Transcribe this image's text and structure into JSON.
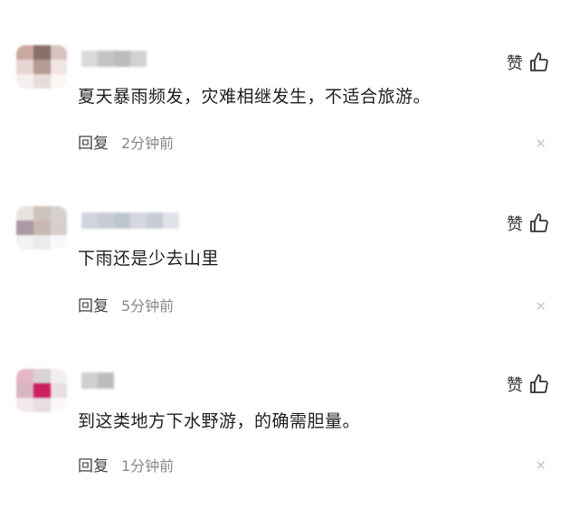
{
  "comments": [
    {
      "text": "夏天暴雨频发，灾难相继发生，不适合旅游。",
      "like_label": "赞",
      "reply_label": "回复",
      "time": "2分钟前",
      "avatar_colors": [
        "#c9a8a0",
        "#8a6f6a",
        "#d8c3bf",
        "#e6d6d3",
        "#b69a94",
        "#f0e5e3",
        "#f5eeee",
        "#e8dcda",
        "#fbf7f7"
      ],
      "name_colors": [
        "#d9d9d9",
        "#c4c4c4",
        "#bcbcbc",
        "#d2d2d2"
      ]
    },
    {
      "text": "下雨还是少去山里",
      "like_label": "赞",
      "reply_label": "回复",
      "time": "5分钟前",
      "avatar_colors": [
        "#e7e2df",
        "#cfc3bd",
        "#d6d0ce",
        "#a99aa5",
        "#c9b7b3",
        "#d8cfcc",
        "#f3f1f1",
        "#eceaea",
        "#faf9f9"
      ],
      "name_colors": [
        "#d0d4dc",
        "#c8ccd4",
        "#bfc5cf",
        "#d5d8de",
        "#c7ccd5",
        "#dfe2e7"
      ]
    },
    {
      "text": "到这类地方下水野游，的确需胆量。",
      "like_label": "赞",
      "reply_label": "回复",
      "time": "1分钟前",
      "avatar_colors": [
        "#e6b6c4",
        "#d8d2d4",
        "#f3eff0",
        "#d8b5bf",
        "#cc1f5e",
        "#e9dfe2",
        "#f2e9ec",
        "#eadde1",
        "#fbf8f9"
      ],
      "name_colors": [
        "#cfcfcf",
        "#bdbdbd"
      ]
    }
  ],
  "colors": {
    "text": "#1e1e1e",
    "secondary": "#888888",
    "close": "#c8c8c8"
  },
  "icons": {
    "like": "thumbs-up-icon",
    "close": "close-icon"
  }
}
